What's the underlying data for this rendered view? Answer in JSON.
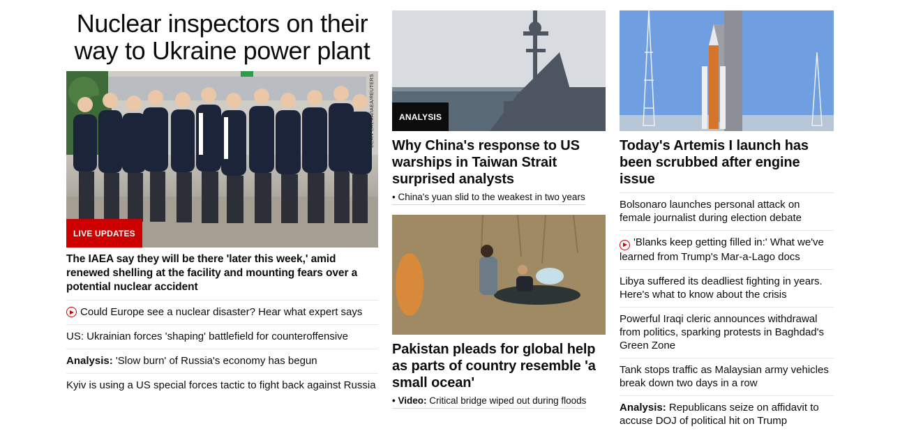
{
  "lead": {
    "headline": "Nuclear inspectors on their way to Ukraine power plant",
    "image_credit": "DEAN CALMA/IAEA/REUTERS",
    "badge": "LIVE UPDATES",
    "summary": "The IAEA say they will be there 'later this week,' amid renewed shelling at the facility and mounting fears over a potential nuclear accident",
    "links": [
      {
        "prefix": "",
        "text": "Could Europe see a nuclear disaster? Hear what expert says",
        "video": true
      },
      {
        "prefix": "",
        "text": "US: Ukrainian forces 'shaping' battlefield for counteroffensive",
        "video": false
      },
      {
        "prefix": "Analysis:",
        "text": " 'Slow burn' of Russia's economy has begun",
        "video": false
      },
      {
        "prefix": "",
        "text": "Kyiv is using a US special forces tactic to fight back against Russia",
        "video": false
      }
    ]
  },
  "story_china": {
    "badge": "ANALYSIS",
    "headline": "Why China's response to US warships in Taiwan Strait surprised analysts",
    "sub": "• China's yuan slid to the weakest in two years"
  },
  "story_pakistan": {
    "headline": "Pakistan pleads for global help as parts of country resemble 'a small ocean'",
    "sub_prefix": "• Video:",
    "sub_text": " Critical bridge wiped out during floods"
  },
  "story_artemis": {
    "headline": "Today's Artemis I launch has been scrubbed after engine issue",
    "links": [
      {
        "prefix": "",
        "text": "Bolsonaro launches personal attack on female journalist during election debate",
        "video": false
      },
      {
        "prefix": "",
        "text": "'Blanks keep getting filled in:' What we've learned from Trump's Mar-a-Lago docs",
        "video": true
      },
      {
        "prefix": "",
        "text": "Libya suffered its deadliest fighting in years. Here's what to know about the crisis",
        "video": false
      },
      {
        "prefix": "",
        "text": "Powerful Iraqi cleric announces withdrawal from politics, sparking protests in Baghdad's Green Zone",
        "video": false
      },
      {
        "prefix": "",
        "text": "Tank stops traffic as Malaysian army vehicles break down two days in a row",
        "video": false
      },
      {
        "prefix": "Analysis:",
        "text": " Republicans seize on affidavit to accuse DOJ of political hit on Trump",
        "video": false
      }
    ]
  },
  "colors": {
    "live_badge": "#cc0000",
    "analysis_badge": "#0c0c0c",
    "play_icon": "#cc0000",
    "divider": "#e6e6e6"
  }
}
